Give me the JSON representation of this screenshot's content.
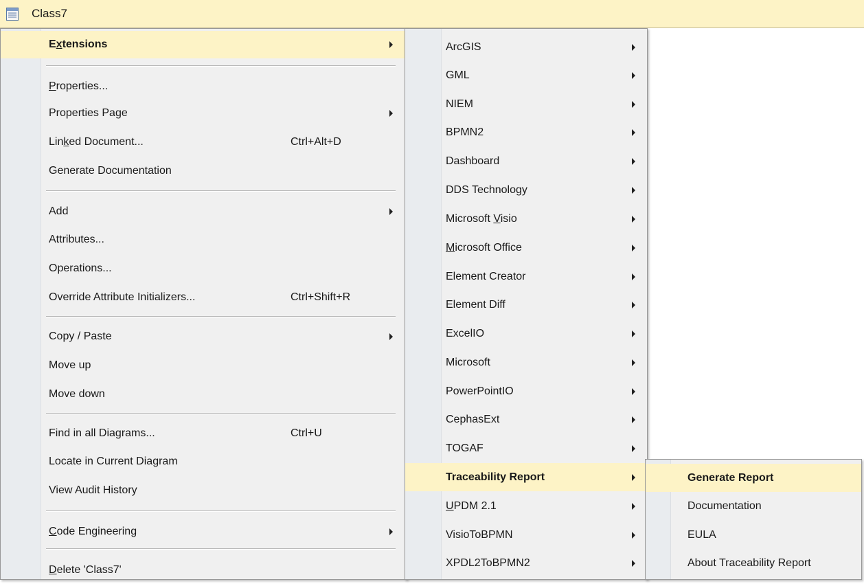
{
  "title": {
    "text": "Class7"
  },
  "menu1": {
    "items": [
      {
        "label": "Extensions",
        "mn": 1,
        "submenu": true,
        "highlighted": true
      },
      {
        "label": "Properties...",
        "mn": 0
      },
      {
        "label": "Properties Page",
        "submenu": true
      },
      {
        "label": "Linked Document...",
        "mn": 3,
        "shortcut": "Ctrl+Alt+D"
      },
      {
        "label": "Generate Documentation"
      },
      {
        "label": "Add",
        "submenu": true
      },
      {
        "label": "Attributes..."
      },
      {
        "label": "Operations..."
      },
      {
        "label": "Override Attribute Initializers...",
        "shortcut": "Ctrl+Shift+R"
      },
      {
        "label": "Copy / Paste",
        "submenu": true
      },
      {
        "label": "Move up"
      },
      {
        "label": "Move down"
      },
      {
        "label": "Find in all Diagrams...",
        "shortcut": "Ctrl+U"
      },
      {
        "label": "Locate in Current Diagram"
      },
      {
        "label": "View Audit History"
      },
      {
        "label": "Code Engineering",
        "mn": 0,
        "submenu": true
      },
      {
        "label": "Delete 'Class7'",
        "mn": 0
      }
    ]
  },
  "menu2": {
    "items": [
      {
        "label": "ArcGIS",
        "submenu": true
      },
      {
        "label": "GML",
        "submenu": true
      },
      {
        "label": "NIEM",
        "submenu": true
      },
      {
        "label": "BPMN2",
        "submenu": true
      },
      {
        "label": "Dashboard",
        "submenu": true
      },
      {
        "label": "DDS Technology",
        "submenu": true
      },
      {
        "label": "Microsoft Visio",
        "mn": 10,
        "submenu": true
      },
      {
        "label": "Microsoft Office",
        "mn": 0,
        "submenu": true
      },
      {
        "label": "Element Creator",
        "submenu": true
      },
      {
        "label": "Element Diff",
        "submenu": true
      },
      {
        "label": "ExcelIO",
        "submenu": true
      },
      {
        "label": "Microsoft",
        "submenu": true
      },
      {
        "label": "PowerPointIO",
        "submenu": true
      },
      {
        "label": "CephasExt",
        "submenu": true
      },
      {
        "label": "TOGAF",
        "submenu": true
      },
      {
        "label": "Traceability Report",
        "submenu": true,
        "highlighted": true
      },
      {
        "label": "UPDM 2.1",
        "mn": 0,
        "submenu": true
      },
      {
        "label": "VisioToBPMN",
        "submenu": true
      },
      {
        "label": "XPDL2ToBPMN2",
        "submenu": true
      }
    ]
  },
  "menu3": {
    "items": [
      {
        "label": "Generate Report",
        "highlighted": true
      },
      {
        "label": "Documentation"
      },
      {
        "label": "EULA"
      },
      {
        "label": "About Traceability Report"
      }
    ]
  }
}
